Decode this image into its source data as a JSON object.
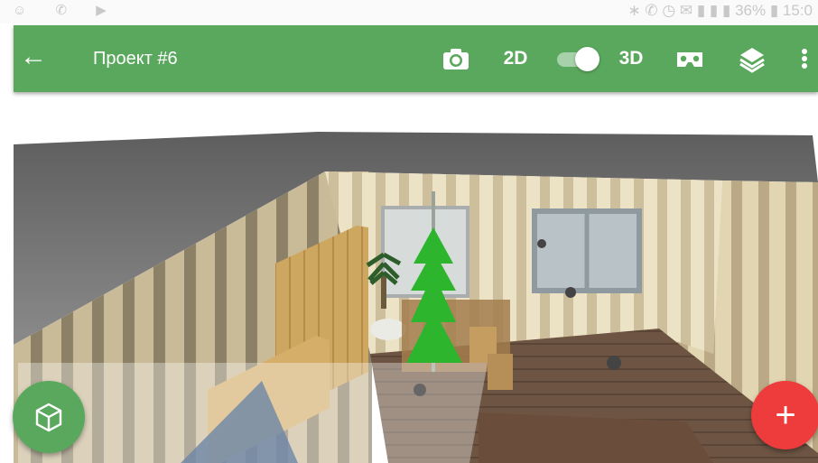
{
  "statusbar": {
    "left_icons": "☺ ✆ ▶",
    "right_text": "∗ ✆ ◷ ✉ ▮ ▮ ▮ 36% ▮ 15:0"
  },
  "toolbar": {
    "title": "Проект #6",
    "mode_2d": "2D",
    "mode_3d": "3D",
    "view_mode": "3D",
    "icons": [
      "arrow-back-icon",
      "camera-icon",
      "vr-cardboard-icon",
      "layers-icon",
      "more-vert-icon"
    ]
  },
  "fab": {
    "left_icon": "cube-icon",
    "right_label": "+"
  },
  "colors": {
    "toolbar": "#5aa85d",
    "fab_add": "#ee3b3b",
    "fab_view": "#5aa85d",
    "tree": "#2db52d"
  }
}
